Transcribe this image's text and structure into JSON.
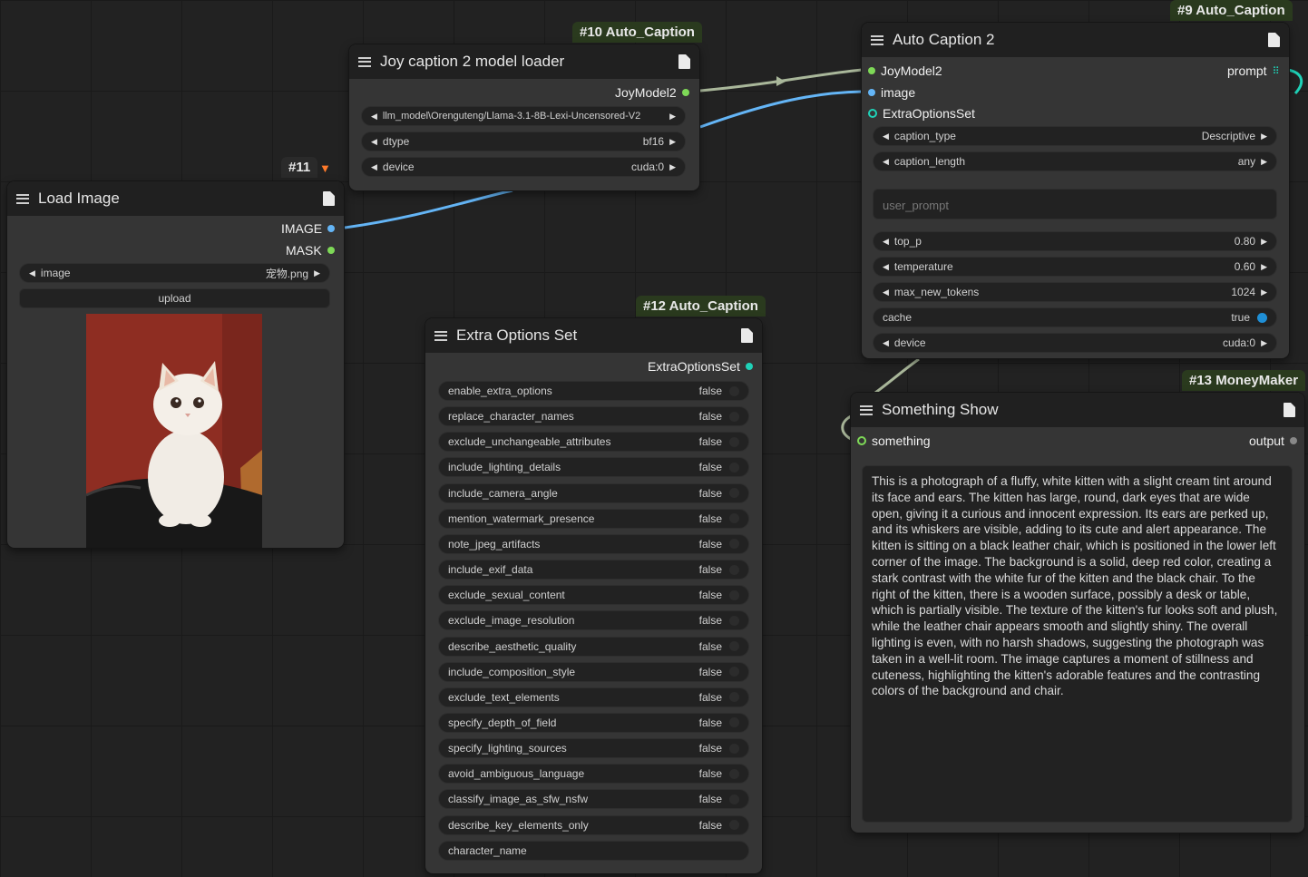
{
  "load_image": {
    "badge": "#11",
    "title": "Load Image",
    "outputs": [
      "IMAGE",
      "MASK"
    ],
    "widget_image_label": "image",
    "widget_image_value": "宠物.png",
    "upload_label": "upload"
  },
  "joy_loader": {
    "badge": "#10 Auto_Caption",
    "title": "Joy caption 2 model loader",
    "output": "JoyModel2",
    "model_path": "llm_model\\Orenguteng/Llama-3.1-8B-Lexi-Uncensored-V2",
    "dtype_label": "dtype",
    "dtype_value": "bf16",
    "device_label": "device",
    "device_value": "cuda:0"
  },
  "auto_caption": {
    "badge": "#9 Auto_Caption",
    "title": "Auto Caption 2",
    "inputs": [
      "JoyModel2",
      "image",
      "ExtraOptionsSet"
    ],
    "output": "prompt",
    "caption_type_label": "caption_type",
    "caption_type_value": "Descriptive",
    "caption_length_label": "caption_length",
    "caption_length_value": "any",
    "user_prompt_placeholder": "user_prompt",
    "top_p_label": "top_p",
    "top_p_value": "0.80",
    "temperature_label": "temperature",
    "temperature_value": "0.60",
    "max_new_tokens_label": "max_new_tokens",
    "max_new_tokens_value": "1024",
    "cache_label": "cache",
    "cache_value": "true",
    "device_label": "device",
    "device_value": "cuda:0"
  },
  "extra_options": {
    "badge": "#12 Auto_Caption",
    "title": "Extra Options Set",
    "output": "ExtraOptionsSet",
    "options": [
      {
        "label": "enable_extra_options",
        "value": "false"
      },
      {
        "label": "replace_character_names",
        "value": "false"
      },
      {
        "label": "exclude_unchangeable_attributes",
        "value": "false"
      },
      {
        "label": "include_lighting_details",
        "value": "false"
      },
      {
        "label": "include_camera_angle",
        "value": "false"
      },
      {
        "label": "mention_watermark_presence",
        "value": "false"
      },
      {
        "label": "note_jpeg_artifacts",
        "value": "false"
      },
      {
        "label": "include_exif_data",
        "value": "false"
      },
      {
        "label": "exclude_sexual_content",
        "value": "false"
      },
      {
        "label": "exclude_image_resolution",
        "value": "false"
      },
      {
        "label": "describe_aesthetic_quality",
        "value": "false"
      },
      {
        "label": "include_composition_style",
        "value": "false"
      },
      {
        "label": "exclude_text_elements",
        "value": "false"
      },
      {
        "label": "specify_depth_of_field",
        "value": "false"
      },
      {
        "label": "specify_lighting_sources",
        "value": "false"
      },
      {
        "label": "avoid_ambiguous_language",
        "value": "false"
      },
      {
        "label": "classify_image_as_sfw_nsfw",
        "value": "false"
      },
      {
        "label": "describe_key_elements_only",
        "value": "false"
      }
    ],
    "character_name_placeholder": "character_name"
  },
  "something_show": {
    "badge": "#13 MoneyMaker",
    "title": "Something Show",
    "input": "something",
    "output": "output",
    "text": "This is a photograph of a fluffy, white kitten with a slight cream tint around its face and ears. The kitten has large, round, dark eyes that are wide open, giving it a curious and innocent expression. Its ears are perked up, and its whiskers are visible, adding to its cute and alert appearance. The kitten is sitting on a black leather chair, which is positioned in the lower left corner of the image. The background is a solid, deep red color, creating a stark contrast with the white fur of the kitten and the black chair. To the right of the kitten, there is a wooden surface, possibly a desk or table, which is partially visible. The texture of the kitten's fur looks soft and plush, while the leather chair appears smooth and slightly shiny. The overall lighting is even, with no harsh shadows, suggesting the photograph was taken in a well-lit room. The image captures a moment of stillness and cuteness, highlighting the kitten's adorable features and the contrasting colors of the background and chair."
  },
  "colors": {
    "canvas": "#222222",
    "node_body": "#353535",
    "node_header": "#202020",
    "badge_bg": "#2a3a1e",
    "wire_model": "#a9b79a",
    "wire_image": "#64b5f6",
    "wire_options": "#1fd2b8"
  }
}
